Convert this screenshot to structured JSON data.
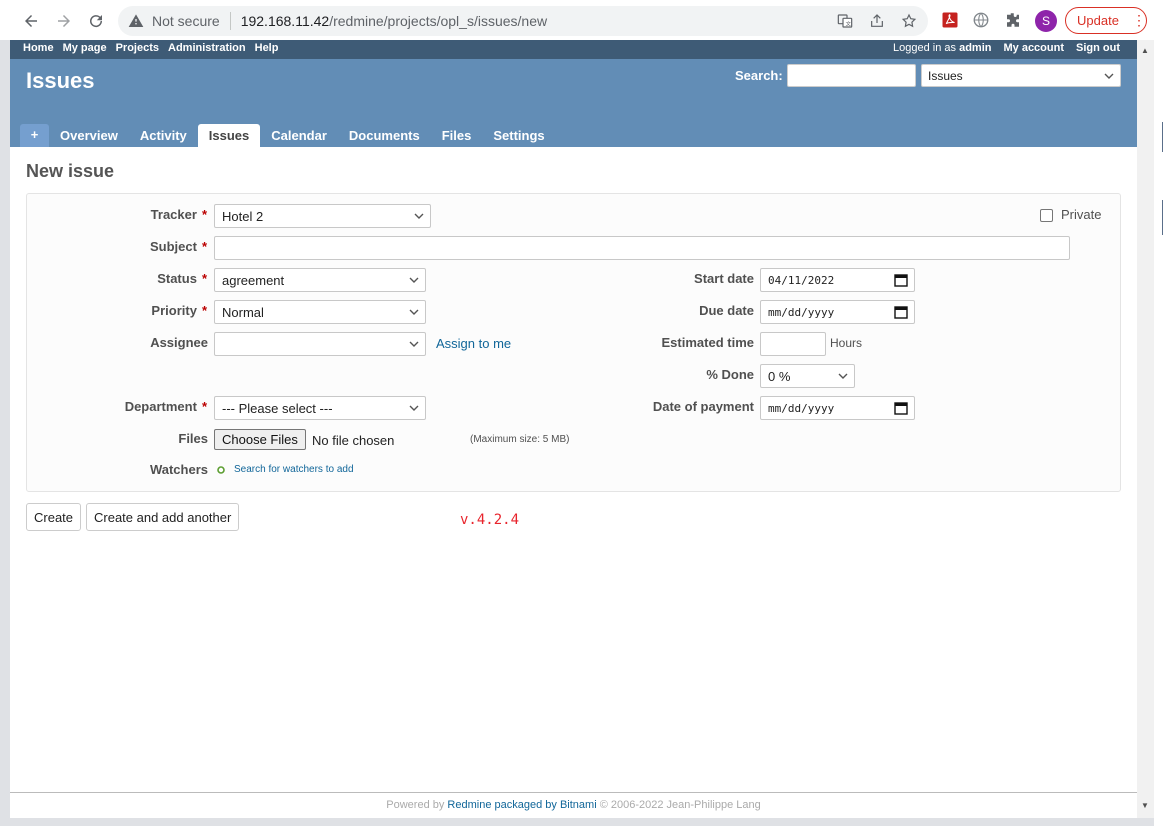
{
  "browser": {
    "security_label": "Not secure",
    "url_host": "192.168.11.42",
    "url_path": "/redmine/projects/opl_s/issues/new",
    "profile_initial": "S",
    "update_label": "Update"
  },
  "top_menu": {
    "items": [
      "Home",
      "My page",
      "Projects",
      "Administration",
      "Help"
    ],
    "logged_in_prefix": "Logged in as",
    "logged_in_user": "admin",
    "my_account": "My account",
    "sign_out": "Sign out"
  },
  "header": {
    "title": "Issues",
    "search_label": "Search:",
    "search_value": "",
    "search_scope": "Issues"
  },
  "tabs": {
    "plus": "+",
    "items": [
      "Overview",
      "Activity",
      "Issues",
      "Calendar",
      "Documents",
      "Files",
      "Settings"
    ],
    "selected": "Issues"
  },
  "page": {
    "heading": "New issue"
  },
  "form": {
    "tracker_label": "Tracker",
    "tracker_value": "Hotel 2",
    "private_label": "Private",
    "subject_label": "Subject",
    "subject_value": "",
    "status_label": "Status",
    "status_value": "agreement",
    "priority_label": "Priority",
    "priority_value": "Normal",
    "assignee_label": "Assignee",
    "assignee_value": "",
    "assign_to_me": "Assign to me",
    "start_date_label": "Start date",
    "start_date_value": "04/11/2022",
    "due_date_label": "Due date",
    "due_date_value": "mm/dd/yyyy",
    "estimated_time_label": "Estimated time",
    "estimated_time_value": "",
    "hours_label": "Hours",
    "done_label": "% Done",
    "done_value": "0 %",
    "department_label": "Department",
    "department_value": "--- Please select ---",
    "date_of_payment_label": "Date of payment",
    "date_of_payment_value": "mm/dd/yyyy",
    "files_label": "Files",
    "choose_files": "Choose Files",
    "no_file": "No file chosen",
    "max_size": "(Maximum size: 5 MB)",
    "watchers_label": "Watchers",
    "search_watchers": "Search for watchers to add",
    "required_mark": "*"
  },
  "actions": {
    "create": "Create",
    "create_and_add": "Create and add another"
  },
  "version_note": "v.4.2.4",
  "footer": {
    "powered_by": "Powered by",
    "redmine": "Redmine",
    "packaged_by": "packaged by",
    "bitnami": "Bitnami",
    "copyright": "© 2006-2022 Jean-Philippe Lang"
  },
  "colors": {
    "top_menu_bg": "#3e5b76",
    "header_bg": "#628db6",
    "link": "#116699",
    "required": "#bb0000",
    "version_note": "#e8242c"
  }
}
